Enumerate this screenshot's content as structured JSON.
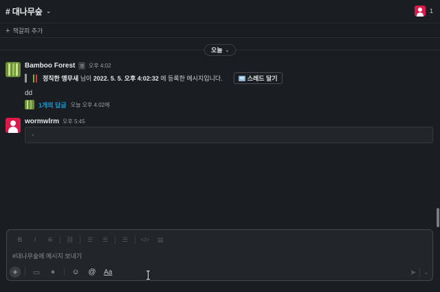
{
  "channel": {
    "prefix": "#",
    "name": "대나무숲",
    "member_count": "1"
  },
  "bookmark": {
    "add_label": "책갈피 추가"
  },
  "date_divider": {
    "label": "오늘"
  },
  "messages": [
    {
      "sender": "Bamboo Forest",
      "badge": "앱",
      "time": "오후 4:02",
      "quote": {
        "author": "정직한 앵무새",
        "middle": " 님이 ",
        "datetime": "2022. 5. 5. 오후 4:02:32",
        "suffix": " 에 등록한 메시지입니다."
      },
      "thread_button": "스레드 달기",
      "body": "dd",
      "replies": {
        "count_label": "1개의 답글",
        "time_label": "오늘 오후 4:02에"
      }
    },
    {
      "sender": "wormwlrm",
      "time": "오후 5:45",
      "code": "."
    }
  ],
  "composer": {
    "placeholder": "#대나무숲에 메시지 보내기",
    "format_label": "Aa"
  },
  "icons": {
    "channel": "hash-icon",
    "add": "plus-icon",
    "thread": "thread-icon",
    "video": "video-icon",
    "mic": "microphone-icon",
    "emoji": "emoji-icon",
    "mention": "at-icon",
    "send": "send-icon"
  },
  "colors": {
    "background": "#1a1d21",
    "link": "#1d9bd1",
    "user_avatar": "#d81b4a",
    "code_text": "#e8912d"
  }
}
